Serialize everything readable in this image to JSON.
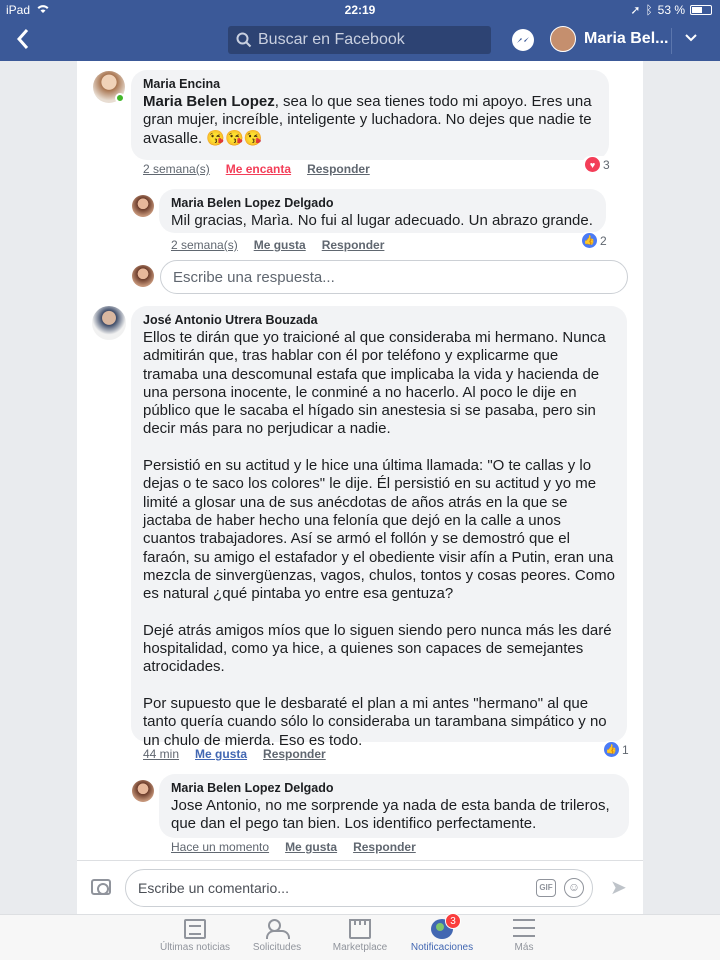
{
  "status_bar": {
    "device": "iPad",
    "time": "22:19",
    "battery": "53 %",
    "battery_level": 0.53
  },
  "nav": {
    "search_placeholder": "Buscar en Facebook",
    "profile_name": "Maria Bel..."
  },
  "comments": [
    {
      "author": "Maria Encina",
      "mention": "Maria Belen Lopez",
      "text": ", sea lo que sea tienes todo mi apoyo. Eres una gran mujer, increíble, inteligente y luchadora. No dejes que nadie te avasalle. 😘😘😘",
      "time": "2 semana(s)",
      "reaction_label": "Me encanta",
      "reply_label": "Responder",
      "reaction_icon": "heart-icon",
      "reaction_count": "3"
    },
    {
      "author": "Maria Belen Lopez Delgado",
      "text": "Mil gracias, Marìa. No fui al lugar adecuado. Un abrazo grande.",
      "time": "2 semana(s)",
      "reaction_label": "Me gusta",
      "reply_label": "Responder",
      "reaction_icon": "thumbs-up-icon",
      "reaction_count": "2"
    },
    {
      "author": "José Antonio Utrera Bouzada",
      "text": "Ellos te dirán que yo traicioné al que consideraba mi hermano. Nunca admitirán que, tras hablar con él por teléfono y explicarme que tramaba una descomunal estafa que implicaba la vida y hacienda de una persona inocente, le conminé a no hacerlo. Al poco le dije en público que le sacaba el hígado sin anestesia si se pasaba, pero sin decir más para no perjudicar a nadie.\n\nPersistió en su actitud y le hice una última llamada: \"O te callas y lo dejas o te saco los colores\" le dije. Él persistió en su actitud y yo me limité a glosar una de sus anécdotas de años atrás en la que se jactaba de haber hecho una felonía que dejó en la calle a unos cuantos trabajadores. Así se armó el follón y se demostró que el faraón, su amigo el estafador y el obediente visir afín a Putin, eran una mezcla de sinvergüenzas, vagos, chulos, tontos y cosas peores. Como es natural ¿qué pintaba yo entre esa gentuza?\n\nDejé atrás amigos míos que lo siguen siendo pero nunca más les daré hospitalidad, como ya hice, a quienes son capaces de semejantes atrocidades.\n\nPor supuesto que le desbaraté el plan a mi antes \"hermano\" al que tanto quería cuando sólo lo consideraba un tarambana simpático y no un chulo de mierda. Eso es todo.",
      "time": "44 min",
      "reaction_label": "Me gusta",
      "reply_label": "Responder",
      "reaction_icon": "thumbs-up-icon",
      "reaction_count": "1"
    },
    {
      "author": "Maria Belen Lopez Delgado",
      "text": "Jose Antonio, no me sorprende ya nada de esta banda de trileros, que dan el pego tan bien. Los identifico perfectamente.",
      "time": "Hace un momento",
      "reaction_label": "Me gusta",
      "reply_label": "Responder"
    }
  ],
  "reply_box": {
    "placeholder": "Escribe una respuesta..."
  },
  "composer": {
    "placeholder": "Escribe un comentario...",
    "gif_label": "GIF"
  },
  "tabs": [
    {
      "label": "Últimas noticias",
      "icon": "news-feed-icon"
    },
    {
      "label": "Solicitudes",
      "icon": "friends-icon"
    },
    {
      "label": "Marketplace",
      "icon": "marketplace-icon"
    },
    {
      "label": "Notificaciones",
      "icon": "globe-icon",
      "badge": "3",
      "active": true
    },
    {
      "label": "Más",
      "icon": "menu-icon"
    }
  ],
  "colors": {
    "brand": "#3b5998",
    "link": "#4267b2",
    "love": "#f33e58",
    "badge": "#fa3e3e"
  }
}
